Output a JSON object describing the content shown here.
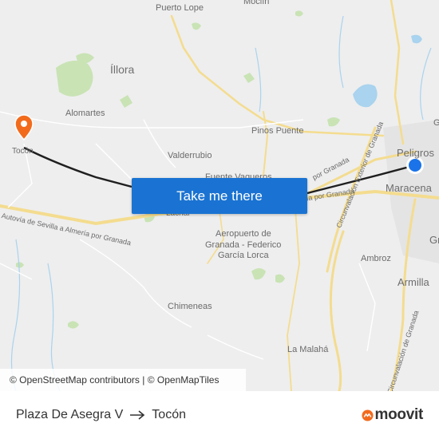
{
  "map": {
    "places": [
      {
        "name": "Puerto Lope",
        "cls": "place"
      },
      {
        "name": "Moclín",
        "cls": "place"
      },
      {
        "name": "Íllora",
        "cls": "place big"
      },
      {
        "name": "Alomartes",
        "cls": "place"
      },
      {
        "name": "Pinos Puente",
        "cls": "place"
      },
      {
        "name": "Valderrubio",
        "cls": "place"
      },
      {
        "name": "Tocón",
        "cls": "place"
      },
      {
        "name": "Peligros",
        "cls": "place mid"
      },
      {
        "name": "Maracena",
        "cls": "place mid"
      },
      {
        "name": "Fuente Vaqueros",
        "cls": "place"
      },
      {
        "name": "Láchar",
        "cls": "place"
      },
      {
        "name": "Aeropuerto de",
        "cls": "place"
      },
      {
        "name": "Granada - Federico",
        "cls": "place"
      },
      {
        "name": "García Lorca",
        "cls": "place"
      },
      {
        "name": "Ambroz",
        "cls": "place"
      },
      {
        "name": "Armilla",
        "cls": "place mid"
      },
      {
        "name": "Chimeneas",
        "cls": "place"
      },
      {
        "name": "La Malahá",
        "cls": "place"
      },
      {
        "name": "Gr",
        "cls": "place mid"
      },
      {
        "name": "G",
        "cls": "place"
      }
    ],
    "road_labels": [
      "Autovía de Sevilla a Almería por Granada",
      "Autovía de Sevilla a Almería por Granada",
      "Circunvalación Exterior de Granada",
      "Circunvalación de Granada",
      "por Granada"
    ],
    "origin_marker": "current-location-dot",
    "destination_marker": "destination-pin-icon",
    "colors": {
      "route": "#1f1f1f",
      "origin": "#1a73e8",
      "destination": "#f26b1d",
      "road": "#f7e3a1",
      "water": "#a9d3ee",
      "park": "#c9e3b5"
    }
  },
  "attribution": "© OpenStreetMap contributors | © OpenMapTiles",
  "cta_label": "Take me there",
  "footer": {
    "from": "Plaza De Asegra V",
    "to": "Tocón",
    "brand": "moovit"
  }
}
